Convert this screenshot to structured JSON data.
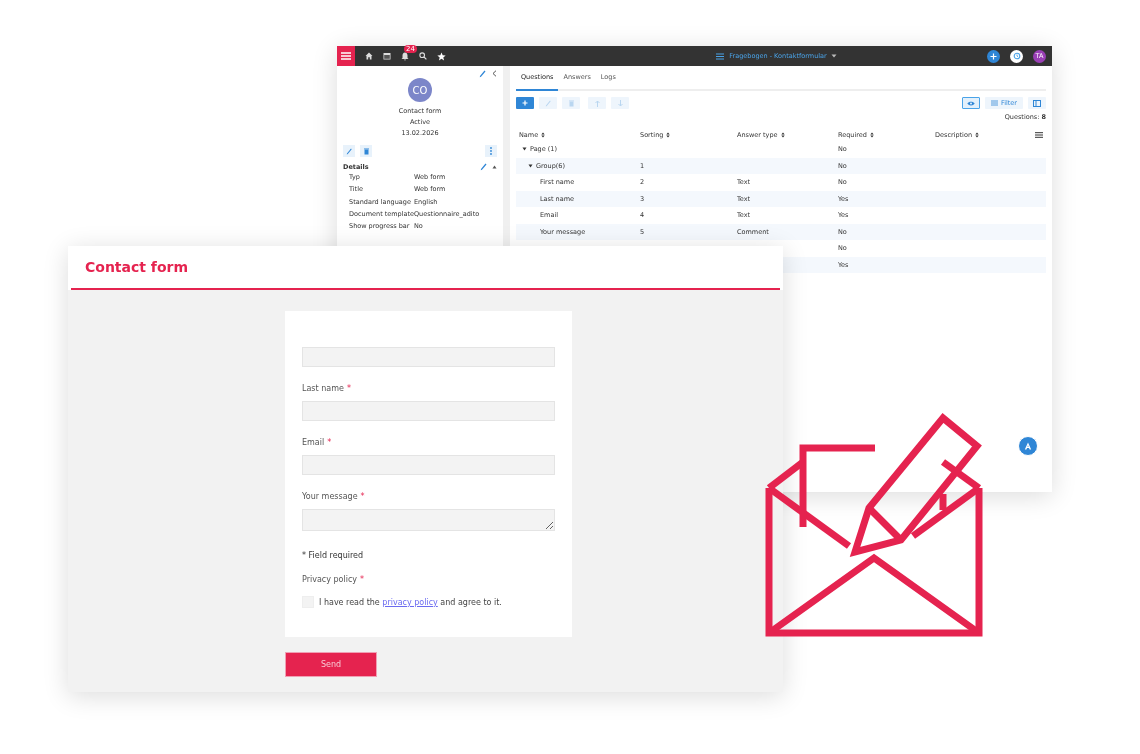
{
  "back_window": {
    "top_bar": {
      "notification_count": "24",
      "title": "Fragebogen - Kontaktformular",
      "user_initials": "TA"
    },
    "sidebar": {
      "avatar_initials": "CO",
      "name": "Contact form",
      "status": "Active",
      "date": "13.02.2026",
      "details_title": "Details",
      "details_expanded": true,
      "details": [
        {
          "label": "Typ",
          "value": "Web form"
        },
        {
          "label": "Title",
          "value": "Web form"
        },
        {
          "label": "Standard language",
          "value": "English"
        },
        {
          "label": "Document template",
          "value": "Questionnaire_adito"
        },
        {
          "label": "Show progress bar",
          "value": "No"
        }
      ]
    },
    "tabs": [
      {
        "label": "Questions",
        "selected": true
      },
      {
        "label": "Answers",
        "selected": false
      },
      {
        "label": "Logs",
        "selected": false
      }
    ],
    "toolbar": {
      "filter_label": "Filter",
      "preview_selected": true
    },
    "question_count": "Questions: **8**",
    "table": {
      "columns": [
        "Name",
        "Sorting",
        "Answer type",
        "Required",
        "Description"
      ],
      "rows": [
        {
          "name": "Page (1)",
          "required": "No",
          "expanded": true,
          "children": [
            {
              "name": "Group(6)",
              "sorting": "1",
              "required": "No",
              "expanded": true,
              "children": [
                {
                  "name": "First name",
                  "sorting": "2",
                  "answer_type": "Text",
                  "required": "No"
                },
                {
                  "name": "Last name",
                  "sorting": "3",
                  "answer_type": "Text",
                  "required": "Yes"
                },
                {
                  "name": "Email",
                  "sorting": "4",
                  "answer_type": "Text",
                  "required": "Yes"
                },
                {
                  "name": "Your message",
                  "sorting": "5",
                  "answer_type": "Comment",
                  "required": "No"
                }
              ]
            },
            {
              "required": "No"
            },
            {
              "required": "Yes"
            }
          ]
        }
      ]
    }
  },
  "front_window": {
    "title": "Contact form",
    "fields": [
      {
        "kind": "input"
      },
      {
        "kind": "input",
        "label": "Last name",
        "required_mark": "*"
      },
      {
        "kind": "input",
        "label": "Email",
        "required_mark": "*"
      },
      {
        "kind": "textarea",
        "label": "Your message",
        "required_mark": "*"
      }
    ],
    "required_note": "* Field required",
    "privacy": {
      "label": "Privacy policy",
      "required_mark": "*",
      "checked": false,
      "text_before": "I have read the",
      "link": "privacy policy",
      "text_after": "and agree to it."
    },
    "submit": "Send"
  }
}
